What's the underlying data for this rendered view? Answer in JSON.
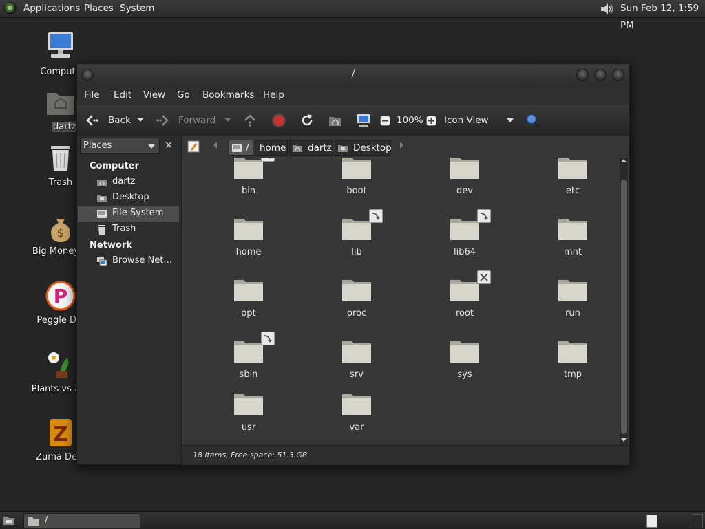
{
  "top_panel": {
    "menus": [
      "Applications",
      "Places",
      "System"
    ],
    "clock": "Sun Feb 12,  1:59 PM"
  },
  "desktop": {
    "icons": [
      {
        "label": "Compute",
        "icon": "computer-icon"
      },
      {
        "label": "dartz's Ho",
        "icon": "home-folder-icon",
        "selected": true
      },
      {
        "label": "Trash",
        "icon": "trash-icon"
      },
      {
        "label": "Big Money D",
        "icon": "money-bag-icon"
      },
      {
        "label": "Peggle Del",
        "icon": "peggle-icon"
      },
      {
        "label": "Plants vs Zor",
        "icon": "plants-icon"
      },
      {
        "label": "Zuma Delu",
        "icon": "zuma-icon"
      }
    ]
  },
  "window": {
    "title": "/",
    "menu": [
      "File",
      "Edit",
      "View",
      "Go",
      "Bookmarks",
      "Help"
    ],
    "toolbar": {
      "back": "Back",
      "forward": "Forward",
      "zoom": "100%",
      "view_mode": "Icon View"
    },
    "sidebar": {
      "combo": "Places",
      "sections": [
        {
          "heading": "Computer",
          "items": [
            {
              "label": "dartz",
              "icon": "home-icon"
            },
            {
              "label": "Desktop",
              "icon": "desktop-icon"
            },
            {
              "label": "File System",
              "icon": "drive-icon",
              "selected": true
            },
            {
              "label": "Trash",
              "icon": "trash-icon"
            }
          ]
        },
        {
          "heading": "Network",
          "items": [
            {
              "label": "Browse Net…",
              "icon": "network-icon"
            }
          ]
        }
      ]
    },
    "breadcrumb": [
      "/",
      "home",
      "dartz",
      "Desktop"
    ],
    "folders": [
      {
        "name": "bin",
        "emblem": "link"
      },
      {
        "name": "boot"
      },
      {
        "name": "dev"
      },
      {
        "name": "etc"
      },
      {
        "name": "home"
      },
      {
        "name": "lib",
        "emblem": "link"
      },
      {
        "name": "lib64",
        "emblem": "link"
      },
      {
        "name": "mnt"
      },
      {
        "name": "opt"
      },
      {
        "name": "proc"
      },
      {
        "name": "root",
        "emblem": "locked"
      },
      {
        "name": "run"
      },
      {
        "name": "sbin",
        "emblem": "link"
      },
      {
        "name": "srv"
      },
      {
        "name": "sys"
      },
      {
        "name": "tmp"
      },
      {
        "name": "usr"
      },
      {
        "name": "var"
      }
    ],
    "status": "18 items, Free space: 51.3 GB"
  },
  "bottom_panel": {
    "task_label": "/"
  }
}
